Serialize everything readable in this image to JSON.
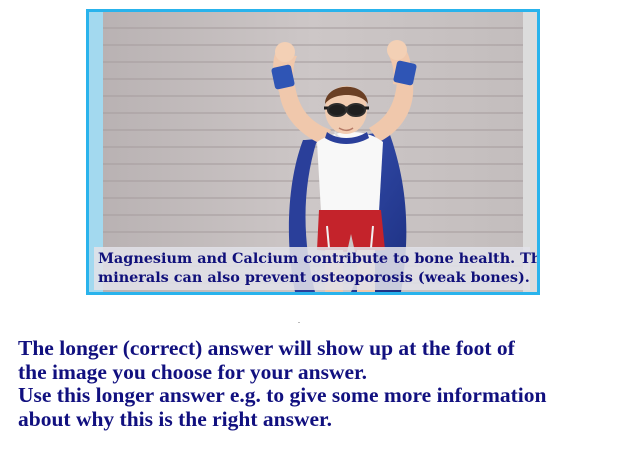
{
  "image_card": {
    "photo_subject": "child-superhero-flexing-photo",
    "caption_lines": [
      "Magnesium and Calcium contribute to bone health. The",
      "minerals can also prevent osteoporosis (weak bones)."
    ]
  },
  "explanation": {
    "lines": [
      "The longer (correct) answer will show up at the foot of",
      "the image you choose for your answer.",
      "Use this longer answer e.g. to give some more information",
      "about why this is the right answer."
    ]
  },
  "colors": {
    "border": "#29b3ec",
    "text": "#11107f",
    "cape": "#2a3f9a",
    "shorts": "#c4232b"
  }
}
